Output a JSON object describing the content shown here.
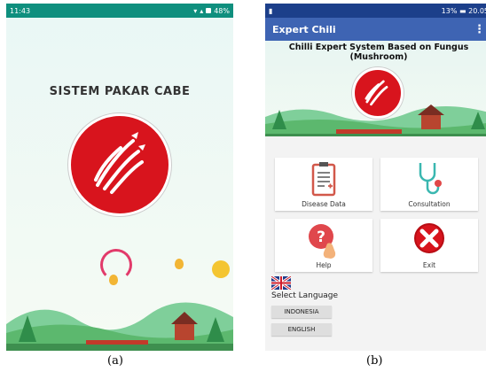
{
  "screen_a": {
    "status_time": "11:43",
    "status_battery": "48%",
    "title": "SISTEM PAKAR CABE",
    "caption": "(a)"
  },
  "screen_b": {
    "status_left": "▮",
    "status_right": "13% ▬ 20.05",
    "app_title": "Expert Chili",
    "menu_icon": "⋮",
    "banner_title": "Chilli Expert System Based on Fungus (Mushroom)",
    "menu": [
      {
        "label": "Disease Data",
        "icon": "document-icon"
      },
      {
        "label": "Consultation",
        "icon": "stethoscope-icon"
      },
      {
        "label": "Help",
        "icon": "question-icon"
      },
      {
        "label": "Exit",
        "icon": "exit-icon"
      }
    ],
    "select_language": "Select Language",
    "languages": [
      "INDONESIA",
      "ENGLISH"
    ],
    "caption": "(b)"
  },
  "colors": {
    "status_a": "#0f8f7e",
    "status_b": "#1c3f8a",
    "appbar": "#3e64b3",
    "logo_red": "#d8141d"
  }
}
